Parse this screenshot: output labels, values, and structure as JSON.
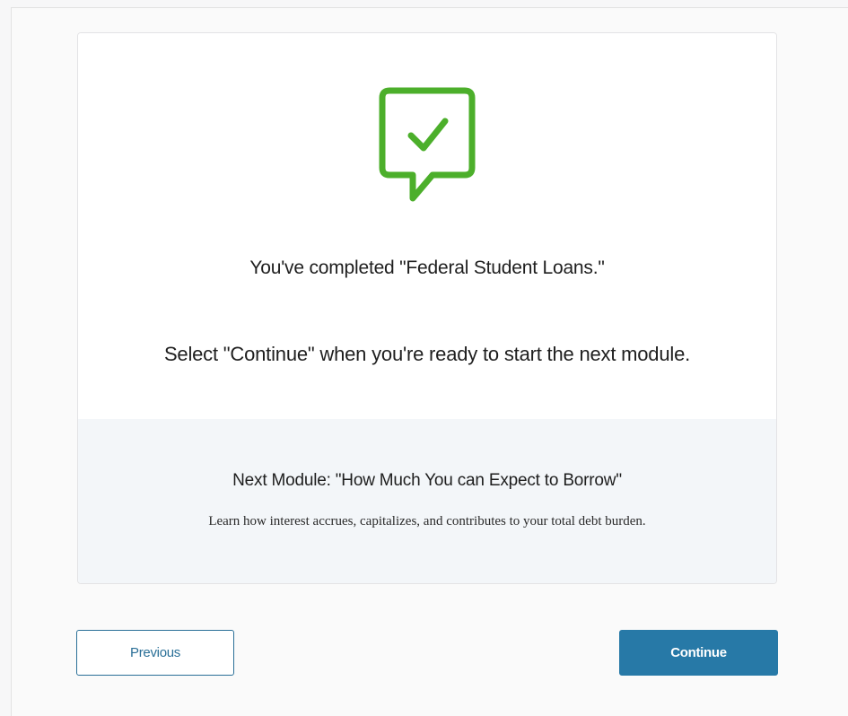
{
  "completion": {
    "icon": "chat-check-icon",
    "icon_color": "#4caf2b",
    "completed_message": "You've completed \"Federal Student Loans.\"",
    "instruction": "Select \"Continue\" when you're ready to start the next module."
  },
  "next_module": {
    "title": "Next Module: \"How Much You can Expect to Borrow\"",
    "description": "Learn how interest accrues, capitalizes, and contributes to your total debt burden."
  },
  "navigation": {
    "previous_label": "Previous",
    "continue_label": "Continue"
  },
  "colors": {
    "accent": "#2779a7",
    "success": "#4caf2b",
    "panel_bg": "#f3f6f9"
  }
}
